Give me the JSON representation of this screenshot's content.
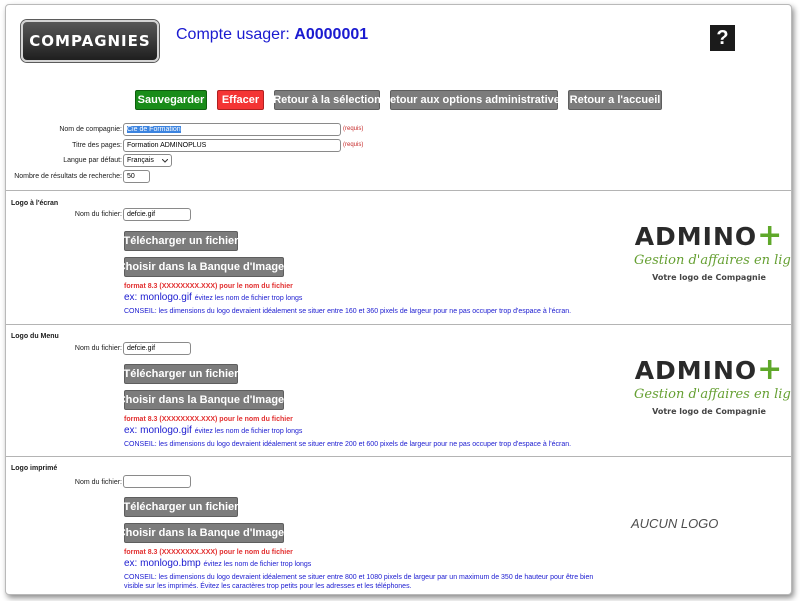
{
  "header": {
    "brand_label": "COMPAGNIES",
    "account_label": "Compte usager:",
    "account_id": "A0000001",
    "help_label": "?"
  },
  "toolbar": {
    "save_label": "Sauvegarder",
    "clear_label": "Effacer",
    "back_selection_label": "Retour à la sélection",
    "back_admin_label": "Retour aux options administratives",
    "back_home_label": "Retour a l'accueil"
  },
  "form": {
    "company_name_label": "Nom de compagnie:",
    "company_name_value": "Cie de Formation",
    "page_title_label": "Titre des pages:",
    "page_title_value": "Formation ADMINOPLUS",
    "required_label": "(requis)",
    "language_label": "Langue par défaut:",
    "language_value": "Français",
    "results_label": "Nombre de résultats de recherche:",
    "results_value": "50"
  },
  "logo_screen": {
    "title": "Logo à l'écran",
    "file_label": "Nom du fichier:",
    "file_value": "defcie.gif",
    "upload_label": "Télécharger un fichier",
    "bank_label": "Choisir dans la Banque d'Images",
    "format_note": "format 8.3 (XXXXXXXX.XXX) pour le nom du fichier",
    "example_main": "ex: monlogo.gif",
    "example_note": "évitez les nom de fichier trop longs",
    "advice": "CONSEIL: les dimensions du logo devraient idéalement se situer entre 160 et 360 pixels de largeur pour ne pas occuper trop d'espace à l'écran.",
    "preview": {
      "brand": "ADMINO",
      "plus": "+",
      "tagline": "Gestion d'affaires en ligne",
      "caption": "Votre logo de Compagnie"
    }
  },
  "logo_menu": {
    "title": "Logo du Menu",
    "file_label": "Nom du fichier:",
    "file_value": "defcie.gif",
    "upload_label": "Télécharger un fichier",
    "bank_label": "Choisir dans la Banque d'Images",
    "format_note": "format 8.3 (XXXXXXXX.XXX) pour le nom du fichier",
    "example_main": "ex: monlogo.gif",
    "example_note": "évitez les nom de fichier trop longs",
    "advice": "CONSEIL: les dimensions du logo devraient idéalement se situer entre 200 et 600 pixels de largeur pour ne pas occuper trop d'espace à l'écran.",
    "preview": {
      "brand": "ADMINO",
      "plus": "+",
      "tagline": "Gestion d'affaires en ligne",
      "caption": "Votre logo de Compagnie"
    }
  },
  "logo_print": {
    "title": "Logo imprimé",
    "file_label": "Nom du fichier:",
    "file_value": "",
    "upload_label": "Télécharger un fichier",
    "bank_label": "Choisir dans la Banque d'Images",
    "format_note": "format 8.3 (XXXXXXXX.XXX) pour le nom du fichier",
    "example_main": "ex: monlogo.bmp",
    "example_note": "évitez les nom de fichier trop longs",
    "advice": "CONSEIL: les dimensions du logo devraient idéalement se situer entre 800 et 1080 pixels de largeur par un maximum de 350 de hauteur pour être bien visible sur les imprimés. Évitez les caractères trop petits pour les adresses et les téléphones.",
    "no_logo": "AUCUN LOGO"
  },
  "colors": {
    "accent_blue": "#1a1ad0",
    "save_green": "#198c19",
    "clear_red": "#f43434",
    "button_grey": "#7c7c7c",
    "required_red": "#c62828",
    "logo_green": "#5fa82a"
  }
}
